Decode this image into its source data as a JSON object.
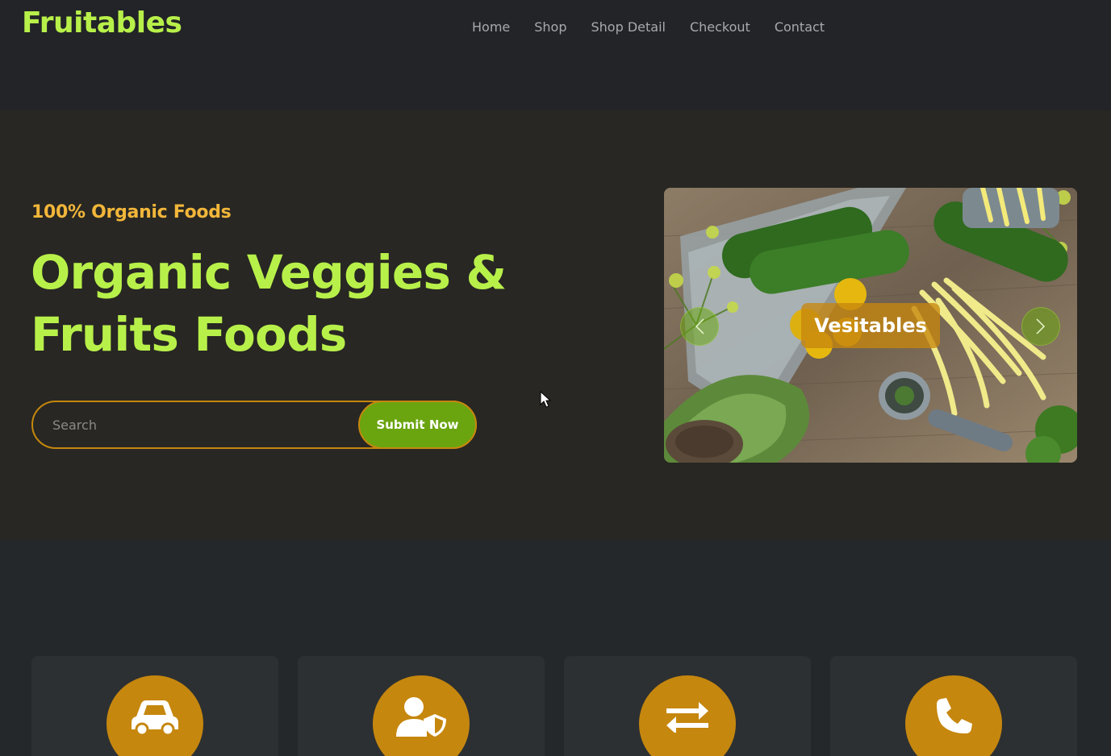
{
  "header": {
    "brand": "Fruitables",
    "nav": [
      "Home",
      "Shop",
      "Shop Detail",
      "Checkout",
      "Contact"
    ]
  },
  "hero": {
    "tagline": "100% Organic Foods",
    "headline": "Organic Veggies & Fruits Foods",
    "search_placeholder": "Search",
    "submit_label": "Submit Now"
  },
  "carousel": {
    "slide_label": "Vesitables",
    "prev_icon": "chevron-left-icon",
    "next_icon": "chevron-right-icon"
  },
  "features": [
    {
      "icon": "car-icon"
    },
    {
      "icon": "user-shield-icon"
    },
    {
      "icon": "exchange-arrows-icon"
    },
    {
      "icon": "phone-icon"
    }
  ],
  "colors": {
    "brand_green": "#b8f04a",
    "accent_orange": "#c6870e",
    "button_green": "#6aa510",
    "tagline_orange": "#f2b63a"
  }
}
